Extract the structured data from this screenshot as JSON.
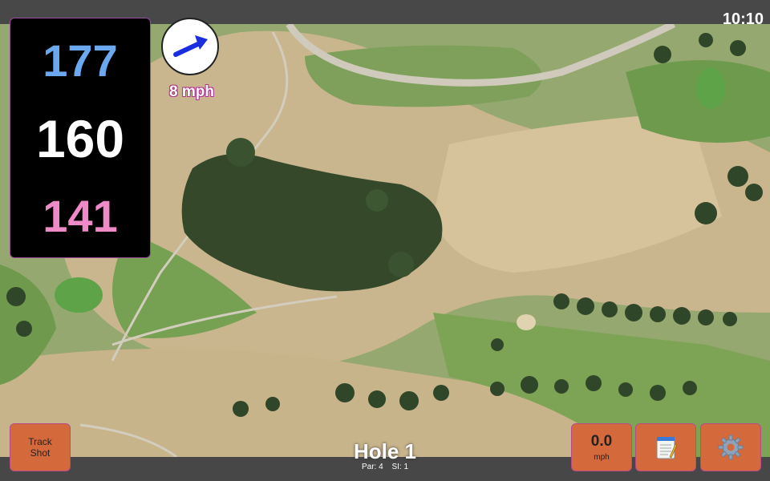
{
  "status_bar": {
    "time": "10:10"
  },
  "distances": {
    "back": "177",
    "middle": "160",
    "front": "141"
  },
  "wind": {
    "speed_label": "8 mph",
    "icon": "wind-direction-arrow-icon"
  },
  "hole": {
    "title": "Hole 1",
    "par": "Par: 4",
    "stroke_index": "SI: 1"
  },
  "buttons": {
    "track_shot": "Track\nShot",
    "speed_value": "0.0",
    "speed_unit": "mph",
    "notes_icon": "notepad-icon",
    "settings_icon": "gear-icon"
  },
  "colors": {
    "back_distance": "#6aa8f0",
    "middle_distance": "#ffffff",
    "front_distance": "#ef8ac8",
    "button_bg": "#d46a3c",
    "accent_border": "#b0318e"
  }
}
